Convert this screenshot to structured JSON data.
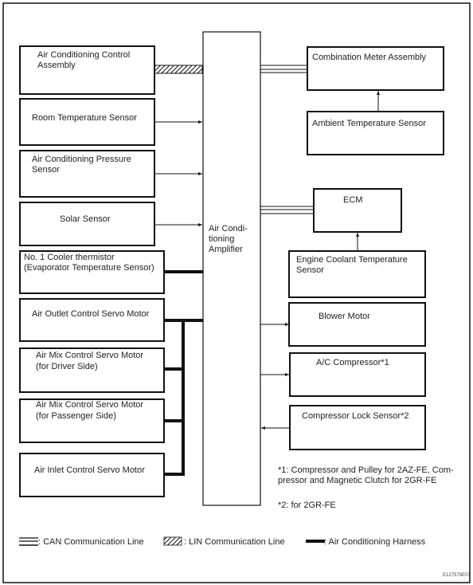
{
  "amplifier": {
    "lines": [
      "Air Condi-",
      "tioning",
      "Amplifier"
    ]
  },
  "left_components": [
    {
      "lines": [
        "Air Conditioning Control",
        "Assembly"
      ]
    },
    {
      "lines": [
        "Room Temperature Sensor"
      ]
    },
    {
      "lines": [
        "Air Conditioning Pressure",
        "Sensor"
      ]
    },
    {
      "lines": [
        "Solar Sensor"
      ]
    },
    {
      "lines": [
        "No. 1 Cooler thermistor",
        "(Evaporator Temperature Sensor)"
      ]
    },
    {
      "lines": [
        "Air Outlet Control Servo Motor"
      ]
    },
    {
      "lines": [
        "Air Mix Control Servo Motor",
        "(for Driver Side)"
      ]
    },
    {
      "lines": [
        "Air Mix Control Servo Motor",
        "(for Passenger Side)"
      ]
    },
    {
      "lines": [
        "Air Inlet Control Servo Motor"
      ]
    }
  ],
  "right_components": [
    {
      "lines": [
        "Combination Meter Assembly"
      ]
    },
    {
      "lines": [
        "Ambient Temperature Sensor"
      ]
    },
    {
      "lines": [
        "ECM"
      ]
    },
    {
      "lines": [
        "Engine Coolant Temperature",
        "Sensor"
      ]
    },
    {
      "lines": [
        "Blower Motor"
      ]
    },
    {
      "lines": [
        "A/C Compressor*1"
      ]
    },
    {
      "lines": [
        "Compressor Lock Sensor*2"
      ]
    }
  ],
  "notes": {
    "note1": [
      "*1: Compressor and Pulley for 2AZ-FE, Com-",
      "pressor and Magnetic Clutch for 2GR-FE"
    ],
    "note2": "*2: for 2GR-FE"
  },
  "legend": {
    "can": ": CAN Communication Line",
    "lin": ": LIN Communication Line",
    "harness": ": Air Conditioning  Harness"
  },
  "figure_id": "E127579E01"
}
